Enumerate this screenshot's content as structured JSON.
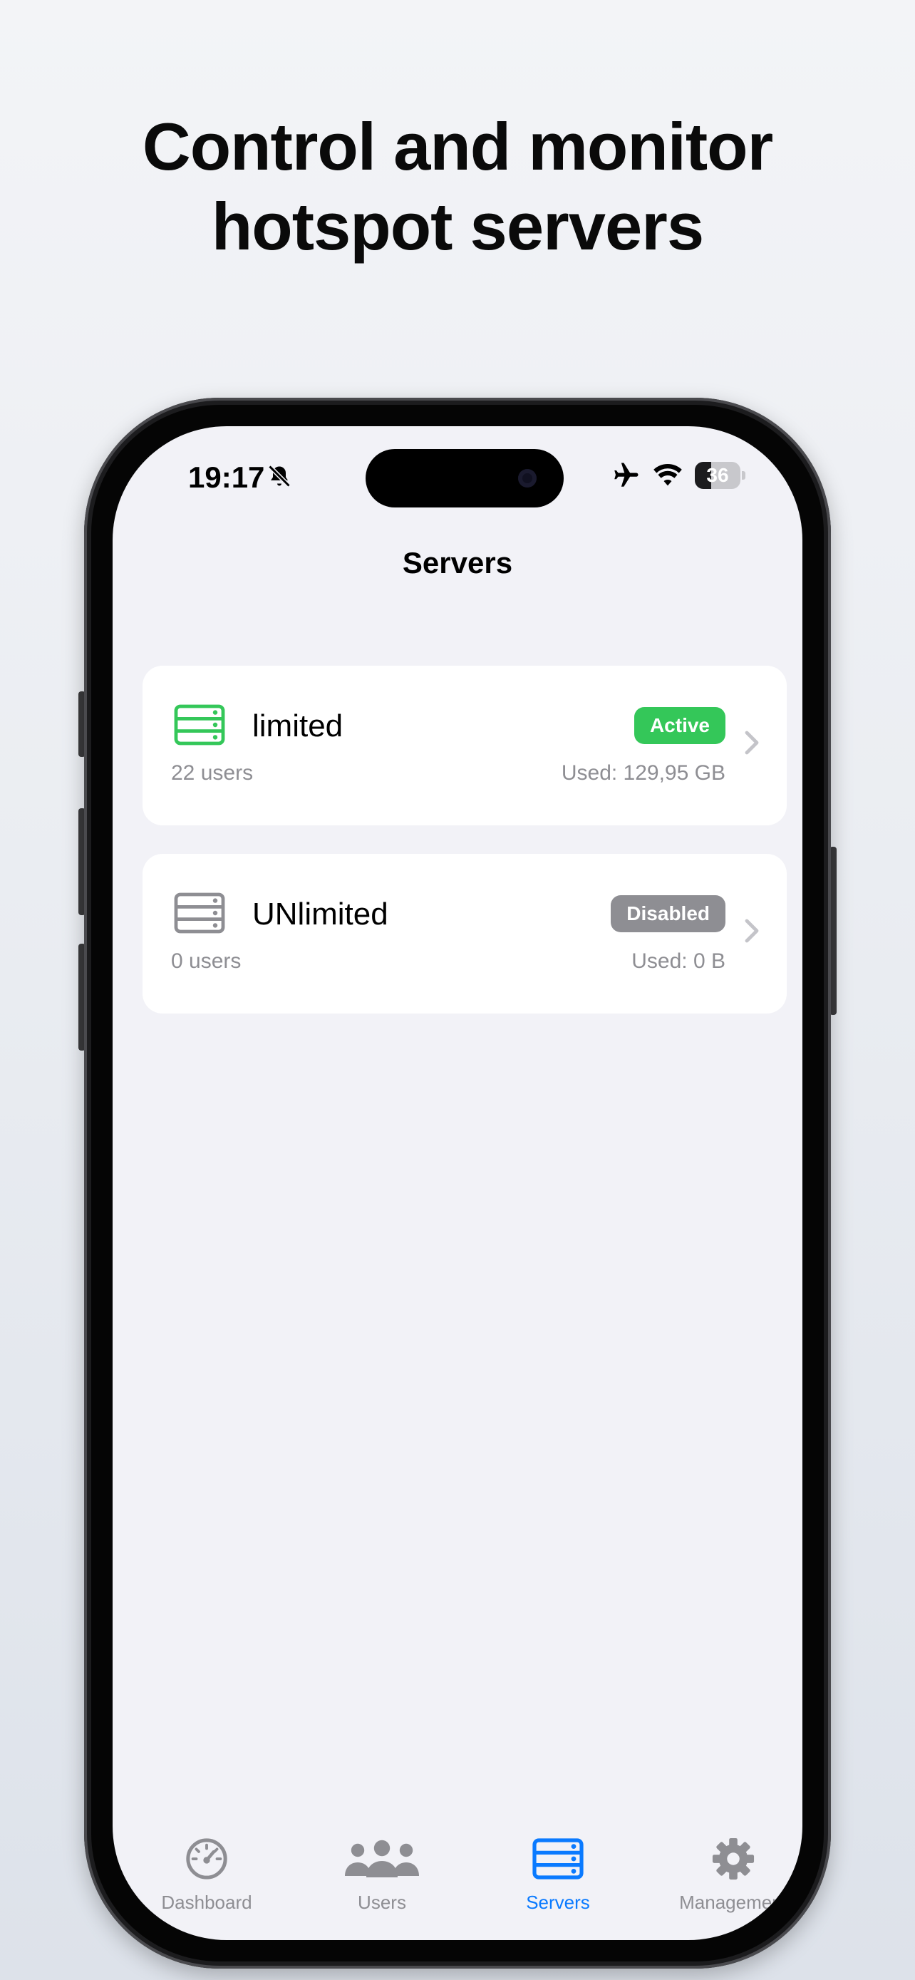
{
  "headline": {
    "line1": "Control and monitor",
    "line2": "hotspot servers"
  },
  "status_bar": {
    "time": "19:17",
    "battery_percent": "36",
    "battery_level": 0.36
  },
  "nav": {
    "title": "Servers"
  },
  "servers": [
    {
      "name": "limited",
      "users": "22 users",
      "status": "Active",
      "used": "Used: 129,95 GB",
      "status_color": "#34c759",
      "icon_color": "#34c759"
    },
    {
      "name": "UNlimited",
      "users": "0 users",
      "status": "Disabled",
      "used": "Used: 0 B",
      "status_color": "#8e8e93",
      "icon_color": "#8e8e93"
    }
  ],
  "tabs": [
    {
      "label": "Dashboard",
      "icon": "speedometer-icon",
      "selected": false
    },
    {
      "label": "Users",
      "icon": "users-icon",
      "selected": false
    },
    {
      "label": "Servers",
      "icon": "server-icon",
      "selected": true
    },
    {
      "label": "Management",
      "icon": "gear-icon",
      "selected": false
    }
  ],
  "colors": {
    "accent": "#0a7aff",
    "inactive": "#8e8e93",
    "active_green": "#34c759"
  }
}
